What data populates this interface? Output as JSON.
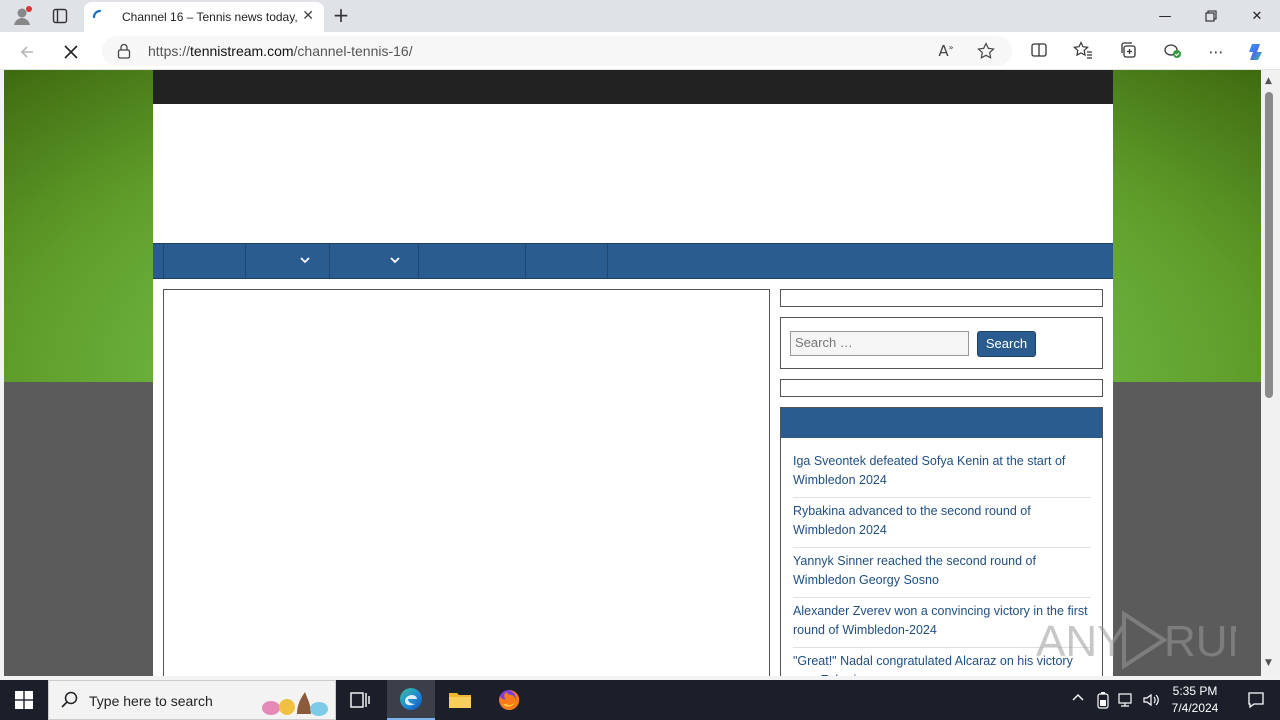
{
  "browser": {
    "tab_title": "Channel 16 – Tennis news today, ",
    "url_domain": "tennistream.com",
    "url_path": "/channel-tennis-16/",
    "url_scheme": "https://",
    "icons": [
      "profile-icon",
      "tab-actions-icon",
      "back-icon",
      "stop-loading-icon",
      "lock-icon",
      "read-aloud-icon",
      "favorite-icon",
      "split-screen-icon",
      "favorites-icon",
      "collections-icon",
      "extensions-icon",
      "more-icon",
      "copilot-icon"
    ]
  },
  "site": {
    "search_placeholder": "Search …",
    "search_button": "Search",
    "recent_posts": [
      "Iga Sveontek defeated Sofya Kenin at the start of Wimbledon 2024",
      "Rybakina advanced to the second round of Wimbledon 2024",
      "Yannyk Sinner reached the second round of Wimbledon Georgy Sosno",
      "Alexander Zverev won a convincing victory in the first round of Wimbledon-2024",
      "\"Great!\" Nadal congratulated Alcaraz on his victory over Zahariev"
    ],
    "colors": {
      "nav": "#2b5c8f",
      "topbar": "#222222",
      "link": "#1f4f82"
    }
  },
  "watermark": "ANY RUN",
  "taskbar": {
    "search_text": "Type here to search",
    "time": "5:35 PM",
    "date": "7/4/2024"
  }
}
